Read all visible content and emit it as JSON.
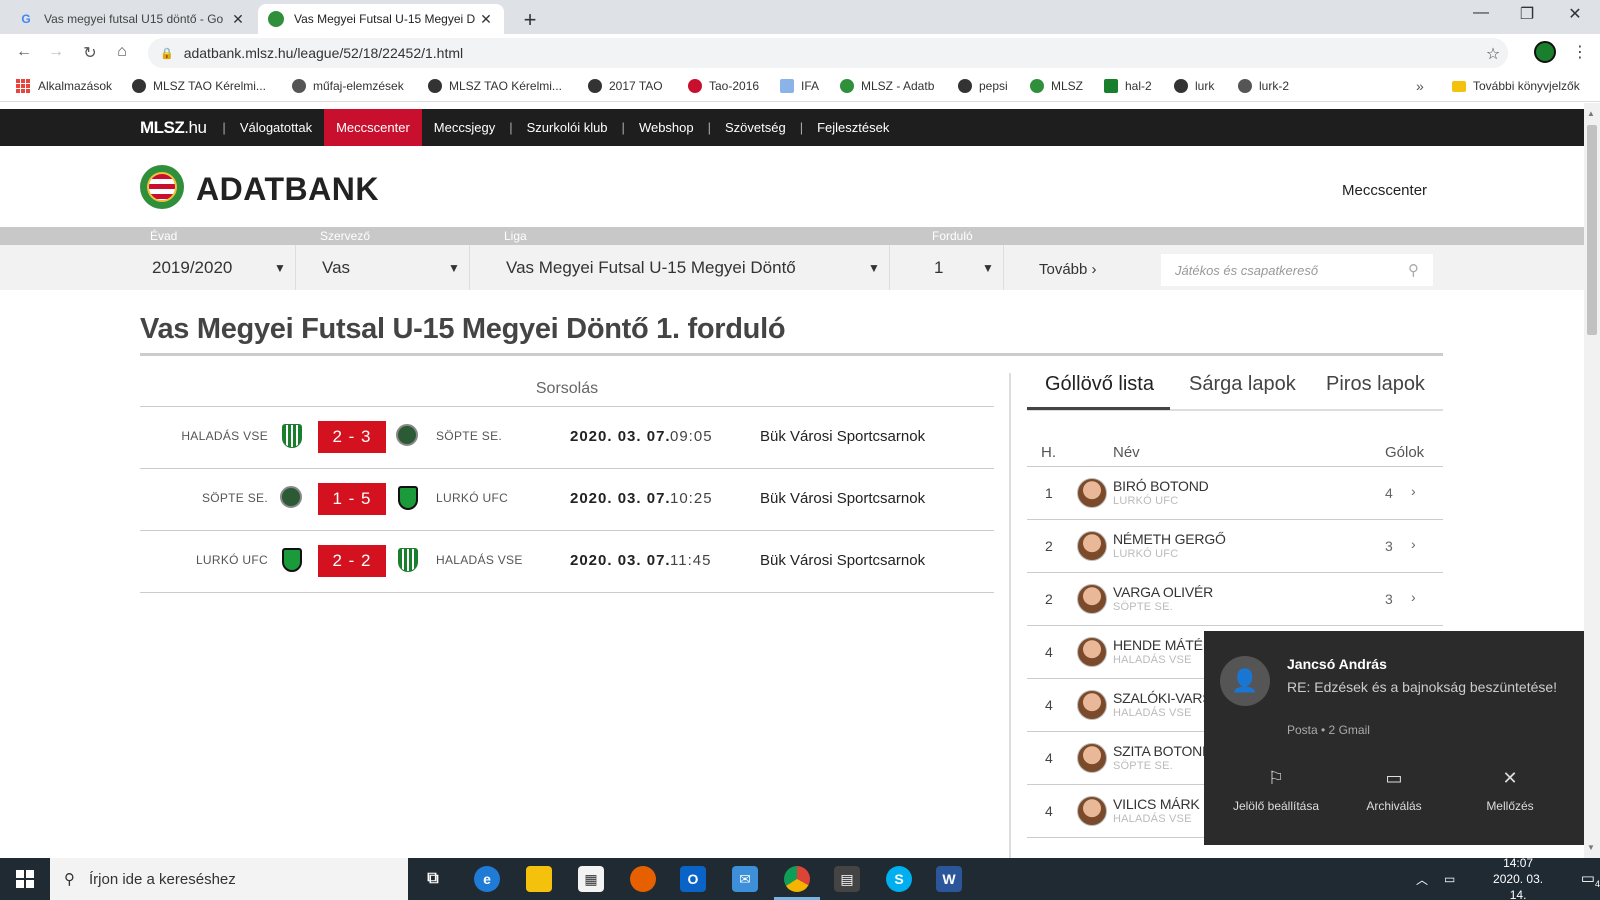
{
  "browser": {
    "tabs": [
      {
        "title": "Vas megyei futsal U15 döntő - Go",
        "active": false
      },
      {
        "title": "Vas Megyei Futsal U-15 Megyei D",
        "active": true
      }
    ],
    "url": "adatbank.mlsz.hu/league/52/18/22452/1.html",
    "bookmarks": [
      "Alkalmazások",
      "MLSZ TAO Kérelmi...",
      "műfaj-elemzések",
      "MLSZ TAO Kérelmi...",
      "2017 TAO",
      "Tao-2016",
      "IFA",
      "MLSZ - Adatb",
      "pepsi",
      "MLSZ",
      "hal-2",
      "lurk",
      "lurk-2"
    ],
    "bookmarks_more": "»",
    "other_bookmarks": "További könyvjelzők"
  },
  "site": {
    "brand": "MLSZ",
    "brand_suffix": ".hu",
    "nav": [
      "Válogatottak",
      "Meccscenter",
      "Meccsjegy",
      "Szurkolói klub",
      "Webshop",
      "Szövetség",
      "Fejlesztések"
    ],
    "nav_active": "Meccscenter",
    "title": "ADATBANK",
    "header_link": "Meccscenter"
  },
  "filters": {
    "labels": {
      "season": "Évad",
      "organizer": "Szervező",
      "league": "Liga",
      "round": "Forduló"
    },
    "season": "2019/2020",
    "organizer": "Vas",
    "league": "Vas Megyei Futsal U-15 Megyei Döntő",
    "round": "1",
    "more": "Tovább ›",
    "search_placeholder": "Játékos és csapatkereső"
  },
  "page": {
    "title": "Vas Megyei Futsal U-15 Megyei Döntő 1. forduló",
    "schedule_heading": "Sorsolás",
    "matches": [
      {
        "home": "HALADÁS VSE",
        "score": "2 - 3",
        "away": "SÖPTE SE.",
        "date": "2020. 03. 07.",
        "time": "09:05",
        "venue": "Bük Városi Sportcsarnok"
      },
      {
        "home": "SÖPTE SE.",
        "score": "1 - 5",
        "away": "LURKÓ UFC",
        "date": "2020. 03. 07.",
        "time": "10:25",
        "venue": "Bük Városi Sportcsarnok"
      },
      {
        "home": "LURKÓ UFC",
        "score": "2 - 2",
        "away": "HALADÁS VSE",
        "date": "2020. 03. 07.",
        "time": "11:45",
        "venue": "Bük Városi Sportcsarnok"
      }
    ],
    "right_tabs": [
      "Góllövő lista",
      "Sárga lapok",
      "Piros lapok"
    ],
    "scorers_columns": {
      "rank": "H.",
      "name": "Név",
      "goals": "Gólok"
    },
    "scorers": [
      {
        "rank": "1",
        "name": "BIRÓ BOTOND",
        "team": "LURKÓ UFC",
        "goals": "4"
      },
      {
        "rank": "2",
        "name": "NÉMETH GERGŐ",
        "team": "LURKÓ UFC",
        "goals": "3"
      },
      {
        "rank": "2",
        "name": "VARGA OLIVÉR",
        "team": "SÖPTE SE.",
        "goals": "3"
      },
      {
        "rank": "4",
        "name": "HENDE MÁTÉ",
        "team": "HALADÁS VSE",
        "goals": ""
      },
      {
        "rank": "4",
        "name": "SZALÓKI-VARS",
        "team": "HALADÁS VSE",
        "goals": ""
      },
      {
        "rank": "4",
        "name": "SZITA BOTOND",
        "team": "SÖPTE SE.",
        "goals": ""
      },
      {
        "rank": "4",
        "name": "VILICS MÁRK",
        "team": "HALADÁS VSE",
        "goals": ""
      }
    ]
  },
  "notification": {
    "sender": "Jancsó András",
    "subject": "RE: Edzések és a bajnokság beszüntetése!",
    "meta": "Posta • 2 Gmail",
    "actions": [
      "Jelölő beállítása",
      "Archiválás",
      "Mellőzés"
    ]
  },
  "taskbar": {
    "search_placeholder": "Írjon ide a kereséshez",
    "time": "14:07",
    "date": "2020. 03. 14.",
    "notif_count": "4"
  }
}
